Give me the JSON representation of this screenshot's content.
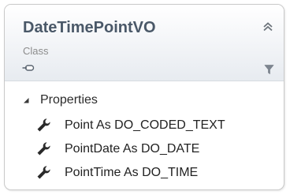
{
  "class_shape": {
    "name": "DateTimePointVO",
    "stereotype": "Class",
    "header_icons": {
      "collapse": "double-chevron-up-icon",
      "link": "link-icon",
      "filter": "filter-icon"
    }
  },
  "sections": [
    {
      "label": "Properties",
      "expanded": true,
      "expander_icon": "triangle-expanded-icon",
      "members": [
        {
          "text": "Point As DO_CODED_TEXT",
          "icon": "wrench-icon"
        },
        {
          "text": "PointDate As DO_DATE",
          "icon": "wrench-icon"
        },
        {
          "text": "PointTime As DO_TIME",
          "icon": "wrench-icon"
        }
      ]
    }
  ],
  "colors": {
    "border": "#c9c9c9",
    "header_top": "#ffffff",
    "header_bottom": "#e7ebf0",
    "title": "#4a5868",
    "stereotype": "#8c8c8c",
    "member_text": "#222222",
    "icon": "#2a2a2a"
  }
}
